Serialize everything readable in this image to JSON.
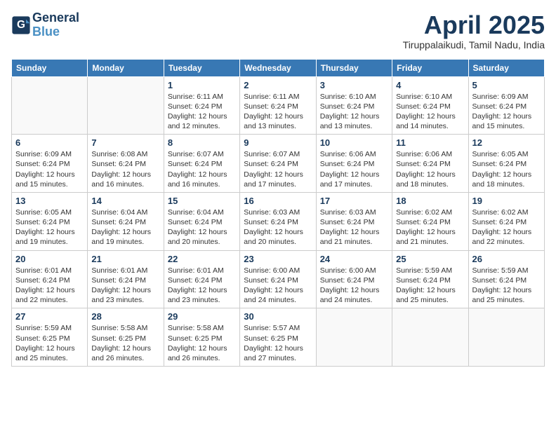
{
  "header": {
    "logo_line1": "General",
    "logo_line2": "Blue",
    "month": "April 2025",
    "location": "Tiruppalaikudi, Tamil Nadu, India"
  },
  "days_of_week": [
    "Sunday",
    "Monday",
    "Tuesday",
    "Wednesday",
    "Thursday",
    "Friday",
    "Saturday"
  ],
  "weeks": [
    [
      {
        "day": "",
        "info": ""
      },
      {
        "day": "",
        "info": ""
      },
      {
        "day": "1",
        "info": "Sunrise: 6:11 AM\nSunset: 6:24 PM\nDaylight: 12 hours and 12 minutes."
      },
      {
        "day": "2",
        "info": "Sunrise: 6:11 AM\nSunset: 6:24 PM\nDaylight: 12 hours and 13 minutes."
      },
      {
        "day": "3",
        "info": "Sunrise: 6:10 AM\nSunset: 6:24 PM\nDaylight: 12 hours and 13 minutes."
      },
      {
        "day": "4",
        "info": "Sunrise: 6:10 AM\nSunset: 6:24 PM\nDaylight: 12 hours and 14 minutes."
      },
      {
        "day": "5",
        "info": "Sunrise: 6:09 AM\nSunset: 6:24 PM\nDaylight: 12 hours and 15 minutes."
      }
    ],
    [
      {
        "day": "6",
        "info": "Sunrise: 6:09 AM\nSunset: 6:24 PM\nDaylight: 12 hours and 15 minutes."
      },
      {
        "day": "7",
        "info": "Sunrise: 6:08 AM\nSunset: 6:24 PM\nDaylight: 12 hours and 16 minutes."
      },
      {
        "day": "8",
        "info": "Sunrise: 6:07 AM\nSunset: 6:24 PM\nDaylight: 12 hours and 16 minutes."
      },
      {
        "day": "9",
        "info": "Sunrise: 6:07 AM\nSunset: 6:24 PM\nDaylight: 12 hours and 17 minutes."
      },
      {
        "day": "10",
        "info": "Sunrise: 6:06 AM\nSunset: 6:24 PM\nDaylight: 12 hours and 17 minutes."
      },
      {
        "day": "11",
        "info": "Sunrise: 6:06 AM\nSunset: 6:24 PM\nDaylight: 12 hours and 18 minutes."
      },
      {
        "day": "12",
        "info": "Sunrise: 6:05 AM\nSunset: 6:24 PM\nDaylight: 12 hours and 18 minutes."
      }
    ],
    [
      {
        "day": "13",
        "info": "Sunrise: 6:05 AM\nSunset: 6:24 PM\nDaylight: 12 hours and 19 minutes."
      },
      {
        "day": "14",
        "info": "Sunrise: 6:04 AM\nSunset: 6:24 PM\nDaylight: 12 hours and 19 minutes."
      },
      {
        "day": "15",
        "info": "Sunrise: 6:04 AM\nSunset: 6:24 PM\nDaylight: 12 hours and 20 minutes."
      },
      {
        "day": "16",
        "info": "Sunrise: 6:03 AM\nSunset: 6:24 PM\nDaylight: 12 hours and 20 minutes."
      },
      {
        "day": "17",
        "info": "Sunrise: 6:03 AM\nSunset: 6:24 PM\nDaylight: 12 hours and 21 minutes."
      },
      {
        "day": "18",
        "info": "Sunrise: 6:02 AM\nSunset: 6:24 PM\nDaylight: 12 hours and 21 minutes."
      },
      {
        "day": "19",
        "info": "Sunrise: 6:02 AM\nSunset: 6:24 PM\nDaylight: 12 hours and 22 minutes."
      }
    ],
    [
      {
        "day": "20",
        "info": "Sunrise: 6:01 AM\nSunset: 6:24 PM\nDaylight: 12 hours and 22 minutes."
      },
      {
        "day": "21",
        "info": "Sunrise: 6:01 AM\nSunset: 6:24 PM\nDaylight: 12 hours and 23 minutes."
      },
      {
        "day": "22",
        "info": "Sunrise: 6:01 AM\nSunset: 6:24 PM\nDaylight: 12 hours and 23 minutes."
      },
      {
        "day": "23",
        "info": "Sunrise: 6:00 AM\nSunset: 6:24 PM\nDaylight: 12 hours and 24 minutes."
      },
      {
        "day": "24",
        "info": "Sunrise: 6:00 AM\nSunset: 6:24 PM\nDaylight: 12 hours and 24 minutes."
      },
      {
        "day": "25",
        "info": "Sunrise: 5:59 AM\nSunset: 6:24 PM\nDaylight: 12 hours and 25 minutes."
      },
      {
        "day": "26",
        "info": "Sunrise: 5:59 AM\nSunset: 6:24 PM\nDaylight: 12 hours and 25 minutes."
      }
    ],
    [
      {
        "day": "27",
        "info": "Sunrise: 5:59 AM\nSunset: 6:25 PM\nDaylight: 12 hours and 25 minutes."
      },
      {
        "day": "28",
        "info": "Sunrise: 5:58 AM\nSunset: 6:25 PM\nDaylight: 12 hours and 26 minutes."
      },
      {
        "day": "29",
        "info": "Sunrise: 5:58 AM\nSunset: 6:25 PM\nDaylight: 12 hours and 26 minutes."
      },
      {
        "day": "30",
        "info": "Sunrise: 5:57 AM\nSunset: 6:25 PM\nDaylight: 12 hours and 27 minutes."
      },
      {
        "day": "",
        "info": ""
      },
      {
        "day": "",
        "info": ""
      },
      {
        "day": "",
        "info": ""
      }
    ]
  ]
}
